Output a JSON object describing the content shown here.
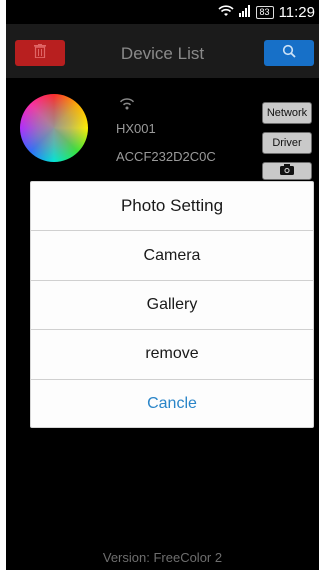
{
  "status_bar": {
    "battery": "83",
    "time": "11:29"
  },
  "header": {
    "title": "Device List",
    "left_icon": "trash-icon",
    "right_icon": "search-icon",
    "colors": {
      "delete": "#b81f1f",
      "search": "#1770c8"
    }
  },
  "device": {
    "name": "HX001",
    "mac": "ACCF232D2C0C",
    "buttons": {
      "network": "Network",
      "driver": "Driver",
      "photo_icon": "camera-icon"
    }
  },
  "dialog": {
    "title": "Photo Setting",
    "options": [
      "Camera",
      "Gallery",
      "remove"
    ],
    "cancel": "Cancle",
    "cancel_color": "#2a85c8"
  },
  "footer": {
    "version": "Version: FreeColor 2"
  }
}
